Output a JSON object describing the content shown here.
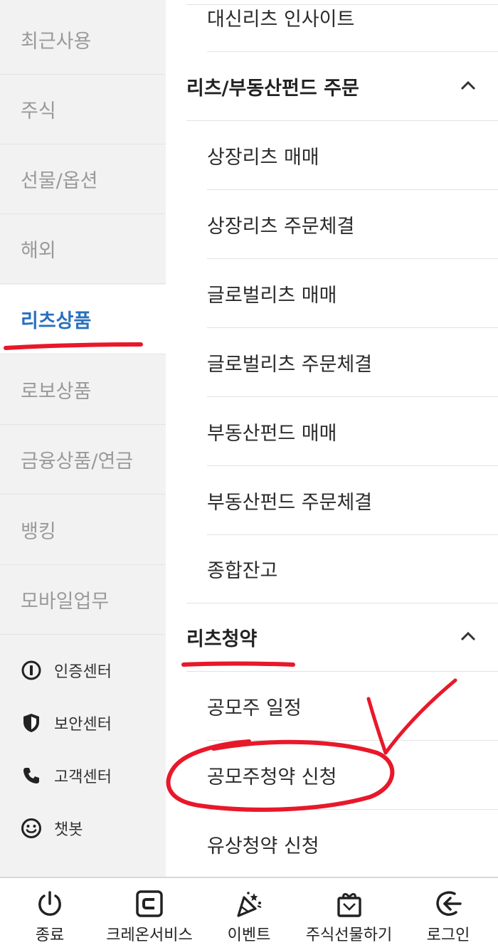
{
  "sidebar": {
    "items": [
      {
        "label": "최근사용"
      },
      {
        "label": "주식"
      },
      {
        "label": "선물/옵션"
      },
      {
        "label": "해외"
      },
      {
        "label": "리츠상품"
      },
      {
        "label": "로보상품"
      },
      {
        "label": "금융상품/연금"
      },
      {
        "label": "뱅킹"
      },
      {
        "label": "모바일업무"
      }
    ],
    "active_index": 4,
    "utilities": [
      {
        "label": "인증센터",
        "icon": "certificate-icon"
      },
      {
        "label": "보안센터",
        "icon": "shield-icon"
      },
      {
        "label": "고객센터",
        "icon": "phone-icon"
      },
      {
        "label": "챗봇",
        "icon": "smile-icon"
      }
    ]
  },
  "menu": {
    "top_item": "대신리츠 인사이트",
    "section1": {
      "title": "리츠/부동산펀드 주문",
      "items": [
        "상장리츠 매매",
        "상장리츠 주문체결",
        "글로벌리츠 매매",
        "글로벌리츠 주문체결",
        "부동산펀드 매매",
        "부동산펀드 주문체결",
        "종합잔고"
      ]
    },
    "section2": {
      "title": "리츠청약",
      "items": [
        "공모주 일정",
        "공모주청약 신청",
        "유상청약 신청"
      ]
    }
  },
  "bottombar": {
    "items": [
      {
        "label": "종료",
        "icon": "power-icon"
      },
      {
        "label": "크레온서비스",
        "icon": "creon-icon"
      },
      {
        "label": "이벤트",
        "icon": "party-icon"
      },
      {
        "label": "주식선물하기",
        "icon": "gift-icon"
      },
      {
        "label": "로그인",
        "icon": "login-icon"
      }
    ]
  },
  "colors": {
    "accent": "#2a6fbd",
    "annotation": "#e8182a"
  }
}
